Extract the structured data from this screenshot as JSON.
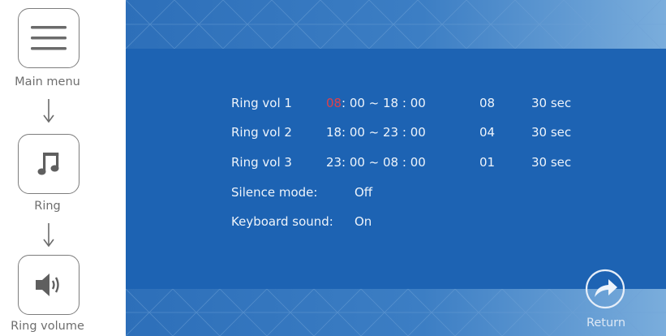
{
  "nav": {
    "items": [
      {
        "label": "Main menu",
        "icon": "menu-icon"
      },
      {
        "label": "Ring",
        "icon": "music-note-icon"
      },
      {
        "label": "Ring volume",
        "icon": "speaker-icon"
      }
    ]
  },
  "settings": {
    "ring_rows": [
      {
        "name": "Ring vol 1",
        "start_hour": "08",
        "rest": ": 00 ~ 18 : 00",
        "volume": "08",
        "duration": "30 sec"
      },
      {
        "name": "Ring vol 2",
        "start_hour": "18",
        "rest": ": 00 ~ 23 : 00",
        "volume": "04",
        "duration": "30 sec"
      },
      {
        "name": "Ring vol 3",
        "start_hour": "23",
        "rest": ": 00 ~ 08 : 00",
        "volume": "01",
        "duration": "30 sec"
      }
    ],
    "silence_mode": {
      "label": "Silence mode:",
      "value": "Off"
    },
    "keyboard_sound": {
      "label": "Keyboard sound:",
      "value": "On"
    }
  },
  "return_button": {
    "label": "Return",
    "icon": "return-arrow-icon"
  },
  "colors": {
    "screen_bg": "#1d63b3",
    "highlight": "#e0404a",
    "text": "#eef4fb"
  }
}
